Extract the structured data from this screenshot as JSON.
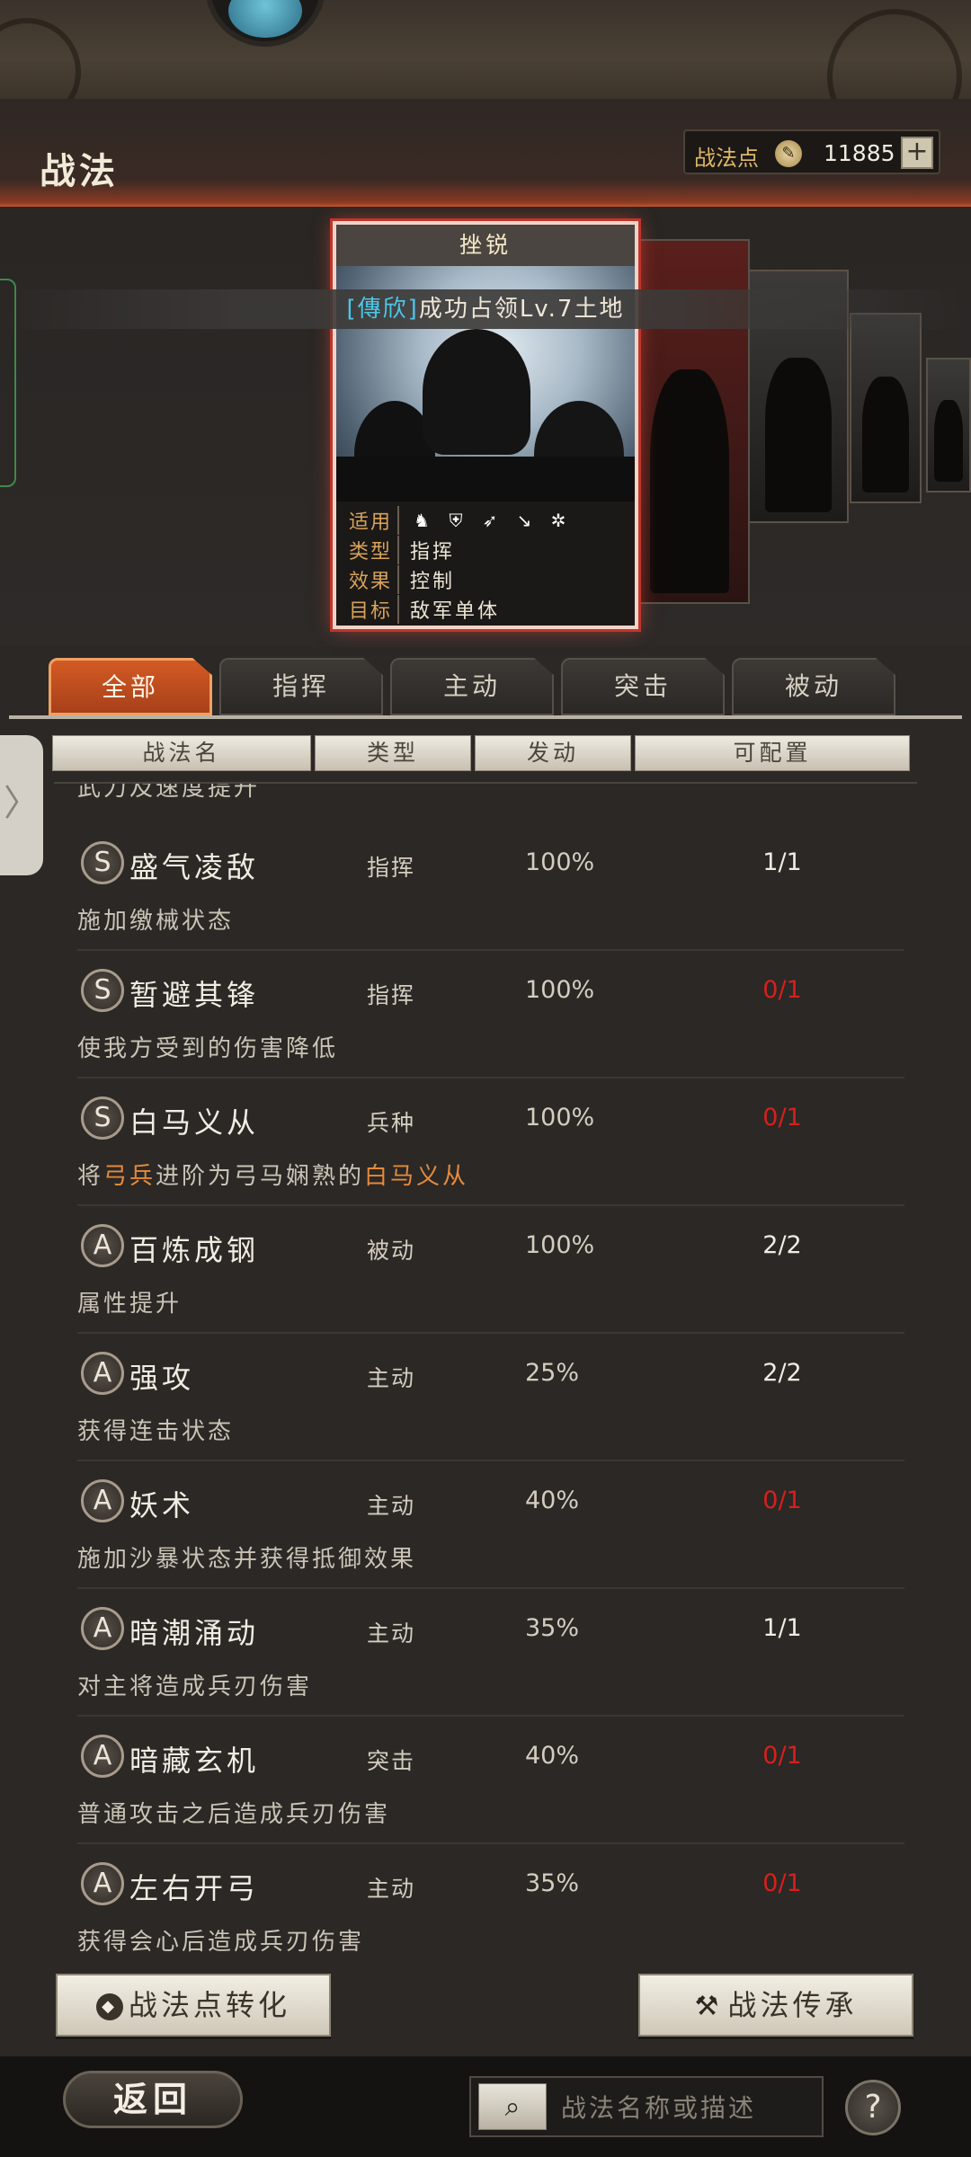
{
  "header": {
    "title": "战法",
    "points_label": "战法点",
    "points_value": "11885",
    "add_symbol": "+"
  },
  "card": {
    "title": "挫锐",
    "condition_tag": "[傳欣]",
    "condition_text": "成功占领Lv.7土地",
    "info": {
      "applicable_label": "适用",
      "type_label": "类型",
      "type_value": "指挥",
      "effect_label": "效果",
      "effect_value": "控制",
      "target_label": "目标",
      "target_value": "敌军单体"
    },
    "unit_icons": [
      "cavalry-icon",
      "shield-icon",
      "bow-icon",
      "spear-icon",
      "chariot-icon"
    ]
  },
  "tabs": [
    {
      "label": "全部",
      "active": true
    },
    {
      "label": "指挥",
      "active": false
    },
    {
      "label": "主动",
      "active": false
    },
    {
      "label": "突击",
      "active": false
    },
    {
      "label": "被动",
      "active": false
    }
  ],
  "columns": [
    "战法名",
    "类型",
    "发动",
    "可配置"
  ],
  "partial_row_text": "武力及速度提升",
  "skills": [
    {
      "grade": "S",
      "name": "盛气凌敌",
      "type": "指挥",
      "rate": "100%",
      "config": "1/1",
      "desc": "施加缴械状态"
    },
    {
      "grade": "S",
      "name": "暂避其锋",
      "type": "指挥",
      "rate": "100%",
      "config": "0/1",
      "desc": "使我方受到的伤害降低"
    },
    {
      "grade": "S",
      "name": "白马义从",
      "type": "兵种",
      "rate": "100%",
      "config": "0/1",
      "desc_pre": "将",
      "desc_hl1": "弓兵",
      "desc_mid": "进阶为弓马娴熟的",
      "desc_hl2": "白马义从"
    },
    {
      "grade": "A",
      "name": "百炼成钢",
      "type": "被动",
      "rate": "100%",
      "config": "2/2",
      "desc": "属性提升"
    },
    {
      "grade": "A",
      "name": "强攻",
      "type": "主动",
      "rate": "25%",
      "config": "2/2",
      "desc": "获得连击状态"
    },
    {
      "grade": "A",
      "name": "妖术",
      "type": "主动",
      "rate": "40%",
      "config": "0/1",
      "desc": "施加沙暴状态并获得抵御效果"
    },
    {
      "grade": "A",
      "name": "暗潮涌动",
      "type": "主动",
      "rate": "35%",
      "config": "1/1",
      "desc": "对主将造成兵刃伤害"
    },
    {
      "grade": "A",
      "name": "暗藏玄机",
      "type": "突击",
      "rate": "40%",
      "config": "0/1",
      "desc": "普通攻击之后造成兵刃伤害"
    },
    {
      "grade": "A",
      "name": "左右开弓",
      "type": "主动",
      "rate": "35%",
      "config": "0/1",
      "desc": "获得会心后造成兵刃伤害"
    }
  ],
  "actions": {
    "convert_label": "战法点转化",
    "inherit_label": "战法传承"
  },
  "footer": {
    "back_label": "返回",
    "search_placeholder": "战法名称或描述",
    "help_symbol": "?"
  },
  "colors": {
    "accent_orange": "#d35a24",
    "zero_config_red": "#d6201c",
    "highlight_orange": "#e58a3a",
    "condition_cyan": "#4cc7e8"
  }
}
